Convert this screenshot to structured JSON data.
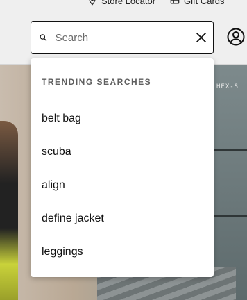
{
  "utility_nav": {
    "store_locator_label": "Store Locator",
    "gift_cards_label": "Gift Cards"
  },
  "search": {
    "placeholder": "Search",
    "value": ""
  },
  "dropdown": {
    "heading": "TRENDING SEARCHES",
    "items": [
      "belt bag",
      "scuba",
      "align",
      "define jacket",
      "leggings"
    ]
  },
  "hero": {
    "sign_text": "HEX-S"
  },
  "colors": {
    "header_bg": "#efefef",
    "border": "#111111",
    "text": "#111111",
    "muted": "#5f5f5f"
  },
  "icons": [
    "location-pin-icon",
    "gift-card-icon",
    "search-icon",
    "close-icon",
    "account-icon"
  ]
}
